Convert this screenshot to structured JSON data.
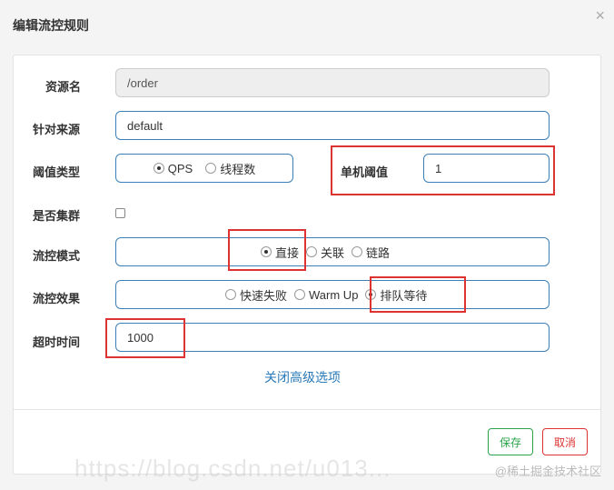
{
  "dialog": {
    "title": "编辑流控规则",
    "close_glyph": "×"
  },
  "form": {
    "resource": {
      "label": "资源名",
      "value": "/order"
    },
    "limit_app": {
      "label": "针对来源",
      "value": "default"
    },
    "threshold_type": {
      "label": "阈值类型",
      "options": [
        "QPS",
        "线程数"
      ],
      "selected": "QPS"
    },
    "single_threshold": {
      "label": "单机阈值",
      "value": "1"
    },
    "cluster": {
      "label": "是否集群",
      "checked": false
    },
    "strategy": {
      "label": "流控模式",
      "options": [
        "直接",
        "关联",
        "链路"
      ],
      "selected": "直接"
    },
    "control_behavior": {
      "label": "流控效果",
      "options": [
        "快速失败",
        "Warm Up",
        "排队等待"
      ],
      "selected": "排队等待"
    },
    "timeout": {
      "label": "超时时间",
      "value": "1000"
    },
    "advanced_link": "关闭高级选项"
  },
  "footer": {
    "save_label": "保存",
    "cancel_label": "取消"
  },
  "watermark": {
    "brand": "@稀土掘金技术社区",
    "url": "https://blog.csdn.net/u013..."
  },
  "colors": {
    "highlight": "#dd3333",
    "input_border": "#3c7fb7",
    "save": "#2ba34a",
    "cancel": "#dd3333",
    "link": "#2a7ab8"
  }
}
